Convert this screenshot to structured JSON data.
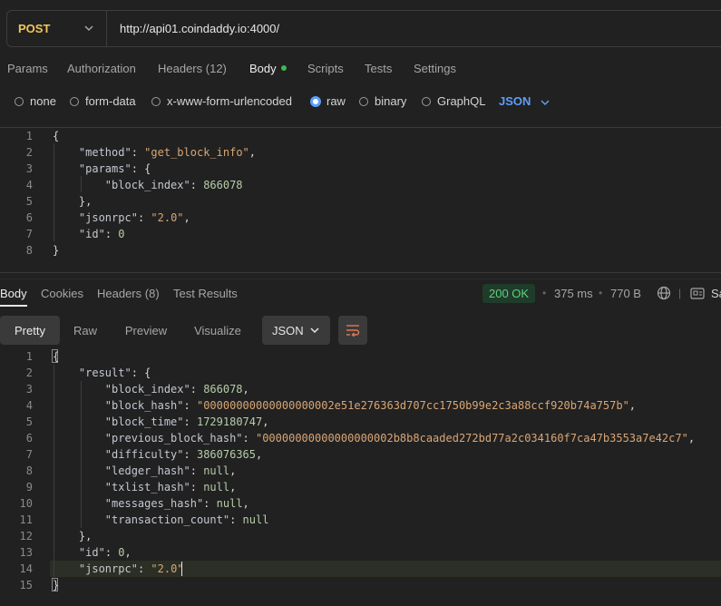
{
  "request": {
    "method": "POST",
    "url": "http://api01.coindaddy.io:4000/",
    "tabs": [
      {
        "label": "Params"
      },
      {
        "label": "Authorization"
      },
      {
        "label": "Headers",
        "count": "(12)"
      },
      {
        "label": "Body"
      },
      {
        "label": "Scripts"
      },
      {
        "label": "Tests"
      },
      {
        "label": "Settings"
      }
    ],
    "body_types": [
      "none",
      "form-data",
      "x-www-form-urlencoded",
      "raw",
      "binary",
      "GraphQL"
    ],
    "selected_body_type": "raw",
    "language": "JSON",
    "body_lines": [
      "{",
      "    \"method\": \"get_block_info\",",
      "    \"params\": {",
      "        \"block_index\": 866078",
      "    },",
      "    \"jsonrpc\": \"2.0\",",
      "    \"id\": 0",
      "}"
    ]
  },
  "response": {
    "tabs": [
      {
        "label": "Body"
      },
      {
        "label": "Cookies"
      },
      {
        "label": "Headers",
        "count": "(8)"
      },
      {
        "label": "Test Results"
      }
    ],
    "status": "200 OK",
    "time": "375 ms",
    "size": "770 B",
    "save_label": "Sa",
    "view_modes": [
      "Pretty",
      "Raw",
      "Preview",
      "Visualize"
    ],
    "format": "JSON",
    "body_lines": [
      "{",
      "    \"result\": {",
      "        \"block_index\": 866078,",
      "        \"block_hash\": \"00000000000000000002e51e276363d707cc1750b99e2c3a88ccf920b74a757b\",",
      "        \"block_time\": 1729180747,",
      "        \"previous_block_hash\": \"00000000000000000002b8b8caaded272bd77a2c034160f7ca47b3553a7e42c7\",",
      "        \"difficulty\": 386076365,",
      "        \"ledger_hash\": null,",
      "        \"txlist_hash\": null,",
      "        \"messages_hash\": null,",
      "        \"transaction_count\": null",
      "    },",
      "    \"id\": 0,",
      "    \"jsonrpc\": \"2.0\"",
      "}"
    ]
  },
  "colors": {
    "method": "#f0c65a",
    "accent": "#5e9ef8",
    "status_ok": "#5fd07f",
    "string": "#d9a675"
  }
}
